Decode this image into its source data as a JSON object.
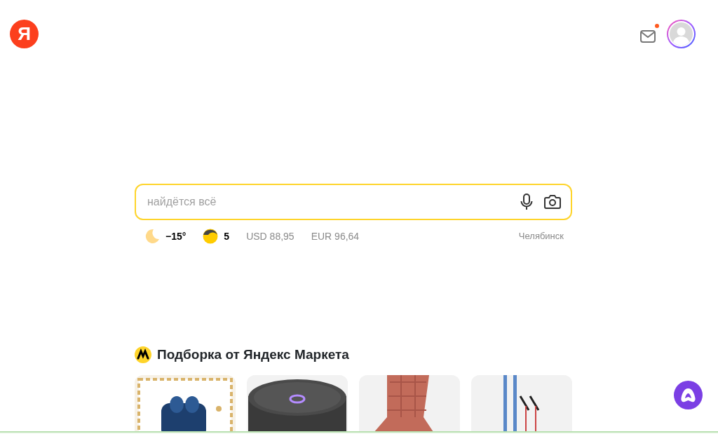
{
  "logo": {
    "text": "Я"
  },
  "mail": {
    "unread": true
  },
  "search": {
    "placeholder": "найдётся всё"
  },
  "informers": [
    {
      "kind": "weather",
      "text": "−15°"
    },
    {
      "kind": "traffic",
      "text": "5"
    },
    {
      "kind": "rate",
      "text": "USD 88,95"
    },
    {
      "kind": "rate",
      "text": "EUR 96,64"
    }
  ],
  "city": "Челябинск",
  "market": {
    "title": "Подборка от Яндекс Маркета"
  }
}
